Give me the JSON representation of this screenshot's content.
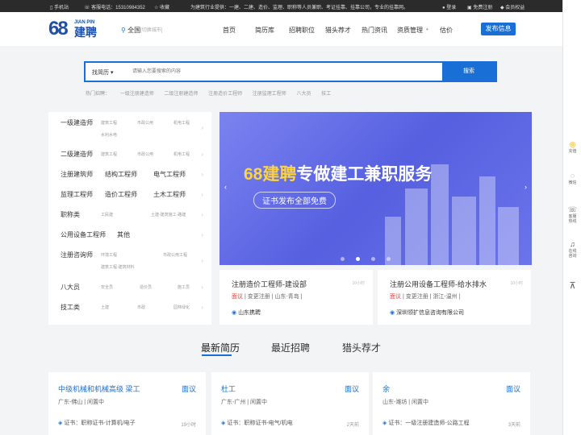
{
  "topbar": {
    "mobile": "手机站",
    "hotline": "客服电话：15310984352",
    "favorite": "收藏",
    "slogan": "为建筑行业提供：一建、二建、造价、监理、职称等人员兼职、考证挂靠、挂靠公司，专业的挂靠网。",
    "login": "登录",
    "register": "免费注册",
    "member": "会员权益"
  },
  "logo": {
    "digits": "68",
    "en": "JIAN PIN",
    "cn": "建聘"
  },
  "location": {
    "city": "全国",
    "switch": "[切换城市]"
  },
  "nav": [
    "首页",
    "简历库",
    "招聘职位",
    "猎头荐才",
    "热门资讯",
    "资质管理",
    "估价"
  ],
  "publish_button": "发布信息",
  "search": {
    "type": "找简历",
    "placeholder": "请输入您要搜索的内容",
    "button": "搜索"
  },
  "hot": {
    "label": "热门招聘：",
    "items": [
      "一级注册建造师",
      "二级注册建造师",
      "注册造价工程师",
      "注册监理工程师",
      "八大员",
      "技工"
    ]
  },
  "categories": [
    {
      "name": "一级建造师",
      "subs": [
        "建筑工程",
        "市政公用",
        "机电工程",
        "水利水电"
      ]
    },
    {
      "name": "二级建造师",
      "subs": [
        "建筑工程",
        "市政公用",
        "机电工程"
      ]
    },
    {
      "name": "注册建筑师",
      "extra": [
        "结构工程师",
        "电气工程师"
      ]
    },
    {
      "name": "监理工程师",
      "extra": [
        "造价工程师",
        "土木工程师"
      ]
    },
    {
      "name": "职称类",
      "subs": [
        "工民建",
        "土建-建筑施工-路建"
      ]
    },
    {
      "name": "公用设备工程师",
      "extra": [
        "其他"
      ]
    },
    {
      "name": "注册咨询师",
      "subs": [
        "环境工程",
        "市政公用工程",
        "建筑工程-建筑材料"
      ]
    },
    {
      "name": "八大员",
      "subs": [
        "安全员",
        "造价员",
        "施工员"
      ]
    },
    {
      "name": "技工类",
      "subs": [
        "土建",
        "市政",
        "园林绿化"
      ]
    }
  ],
  "banner": {
    "title_prefix": "68建聘",
    "title_suffix": "专做建工兼职服务",
    "pill": "证书发布全部免费",
    "slide_count": 4,
    "active_slide": 2
  },
  "jobs": [
    {
      "title": "注册造价工程师-建设部",
      "time": "10小时",
      "tag1": "面议",
      "tag2": "变更注册",
      "tag3": "山东-青岛",
      "company": "山东携聘"
    },
    {
      "title": "注册公用设备工程师-给水排水",
      "time": "10小时",
      "tag1": "面议",
      "tag2": "变更注册",
      "tag3": "浙江-温州",
      "company": "深圳领扩信息咨询有限公司"
    }
  ],
  "tabs": [
    "最新简历",
    "最近招聘",
    "猎头荐才"
  ],
  "resumes": [
    {
      "title": "中级机械和机械高级 梁工",
      "salary": "面议",
      "meta": "广东-佛山  |  闲置中",
      "cert": "证书：职称证书-计算机/电子",
      "time": "19小时"
    },
    {
      "title": "杜工",
      "salary": "面议",
      "meta": "广东-广州  |  闲置中",
      "cert": "证书：职称证书-电气/机电",
      "time": "2天前"
    },
    {
      "title": "余",
      "salary": "面议",
      "meta": "山东-潍坊  |  闲置中",
      "cert": "证书：一级注册建造师-公路工程",
      "time": "3天前"
    }
  ],
  "side": {
    "recharge": "充值",
    "wechat": "微信",
    "hotline": "客服热线",
    "online": "在线咨询"
  },
  "colors": {
    "accent": "#1a6fd6",
    "brand": "#1f4fa8",
    "banner": "#5f68e6",
    "highlight": "#ffd43a",
    "red": "#e23c3c"
  }
}
